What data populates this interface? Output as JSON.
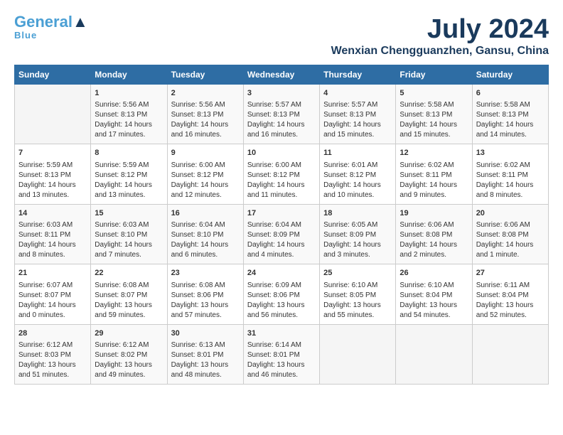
{
  "logo": {
    "line1": "General",
    "line2": "Blue"
  },
  "title": "July 2024",
  "location": "Wenxian Chengguanzhen, Gansu, China",
  "weekdays": [
    "Sunday",
    "Monday",
    "Tuesday",
    "Wednesday",
    "Thursday",
    "Friday",
    "Saturday"
  ],
  "weeks": [
    [
      {
        "day": "",
        "info": ""
      },
      {
        "day": "1",
        "info": "Sunrise: 5:56 AM\nSunset: 8:13 PM\nDaylight: 14 hours\nand 17 minutes."
      },
      {
        "day": "2",
        "info": "Sunrise: 5:56 AM\nSunset: 8:13 PM\nDaylight: 14 hours\nand 16 minutes."
      },
      {
        "day": "3",
        "info": "Sunrise: 5:57 AM\nSunset: 8:13 PM\nDaylight: 14 hours\nand 16 minutes."
      },
      {
        "day": "4",
        "info": "Sunrise: 5:57 AM\nSunset: 8:13 PM\nDaylight: 14 hours\nand 15 minutes."
      },
      {
        "day": "5",
        "info": "Sunrise: 5:58 AM\nSunset: 8:13 PM\nDaylight: 14 hours\nand 15 minutes."
      },
      {
        "day": "6",
        "info": "Sunrise: 5:58 AM\nSunset: 8:13 PM\nDaylight: 14 hours\nand 14 minutes."
      }
    ],
    [
      {
        "day": "7",
        "info": "Sunrise: 5:59 AM\nSunset: 8:13 PM\nDaylight: 14 hours\nand 13 minutes."
      },
      {
        "day": "8",
        "info": "Sunrise: 5:59 AM\nSunset: 8:12 PM\nDaylight: 14 hours\nand 13 minutes."
      },
      {
        "day": "9",
        "info": "Sunrise: 6:00 AM\nSunset: 8:12 PM\nDaylight: 14 hours\nand 12 minutes."
      },
      {
        "day": "10",
        "info": "Sunrise: 6:00 AM\nSunset: 8:12 PM\nDaylight: 14 hours\nand 11 minutes."
      },
      {
        "day": "11",
        "info": "Sunrise: 6:01 AM\nSunset: 8:12 PM\nDaylight: 14 hours\nand 10 minutes."
      },
      {
        "day": "12",
        "info": "Sunrise: 6:02 AM\nSunset: 8:11 PM\nDaylight: 14 hours\nand 9 minutes."
      },
      {
        "day": "13",
        "info": "Sunrise: 6:02 AM\nSunset: 8:11 PM\nDaylight: 14 hours\nand 8 minutes."
      }
    ],
    [
      {
        "day": "14",
        "info": "Sunrise: 6:03 AM\nSunset: 8:11 PM\nDaylight: 14 hours\nand 8 minutes."
      },
      {
        "day": "15",
        "info": "Sunrise: 6:03 AM\nSunset: 8:10 PM\nDaylight: 14 hours\nand 7 minutes."
      },
      {
        "day": "16",
        "info": "Sunrise: 6:04 AM\nSunset: 8:10 PM\nDaylight: 14 hours\nand 6 minutes."
      },
      {
        "day": "17",
        "info": "Sunrise: 6:04 AM\nSunset: 8:09 PM\nDaylight: 14 hours\nand 4 minutes."
      },
      {
        "day": "18",
        "info": "Sunrise: 6:05 AM\nSunset: 8:09 PM\nDaylight: 14 hours\nand 3 minutes."
      },
      {
        "day": "19",
        "info": "Sunrise: 6:06 AM\nSunset: 8:08 PM\nDaylight: 14 hours\nand 2 minutes."
      },
      {
        "day": "20",
        "info": "Sunrise: 6:06 AM\nSunset: 8:08 PM\nDaylight: 14 hours\nand 1 minute."
      }
    ],
    [
      {
        "day": "21",
        "info": "Sunrise: 6:07 AM\nSunset: 8:07 PM\nDaylight: 14 hours\nand 0 minutes."
      },
      {
        "day": "22",
        "info": "Sunrise: 6:08 AM\nSunset: 8:07 PM\nDaylight: 13 hours\nand 59 minutes."
      },
      {
        "day": "23",
        "info": "Sunrise: 6:08 AM\nSunset: 8:06 PM\nDaylight: 13 hours\nand 57 minutes."
      },
      {
        "day": "24",
        "info": "Sunrise: 6:09 AM\nSunset: 8:06 PM\nDaylight: 13 hours\nand 56 minutes."
      },
      {
        "day": "25",
        "info": "Sunrise: 6:10 AM\nSunset: 8:05 PM\nDaylight: 13 hours\nand 55 minutes."
      },
      {
        "day": "26",
        "info": "Sunrise: 6:10 AM\nSunset: 8:04 PM\nDaylight: 13 hours\nand 54 minutes."
      },
      {
        "day": "27",
        "info": "Sunrise: 6:11 AM\nSunset: 8:04 PM\nDaylight: 13 hours\nand 52 minutes."
      }
    ],
    [
      {
        "day": "28",
        "info": "Sunrise: 6:12 AM\nSunset: 8:03 PM\nDaylight: 13 hours\nand 51 minutes."
      },
      {
        "day": "29",
        "info": "Sunrise: 6:12 AM\nSunset: 8:02 PM\nDaylight: 13 hours\nand 49 minutes."
      },
      {
        "day": "30",
        "info": "Sunrise: 6:13 AM\nSunset: 8:01 PM\nDaylight: 13 hours\nand 48 minutes."
      },
      {
        "day": "31",
        "info": "Sunrise: 6:14 AM\nSunset: 8:01 PM\nDaylight: 13 hours\nand 46 minutes."
      },
      {
        "day": "",
        "info": ""
      },
      {
        "day": "",
        "info": ""
      },
      {
        "day": "",
        "info": ""
      }
    ]
  ]
}
